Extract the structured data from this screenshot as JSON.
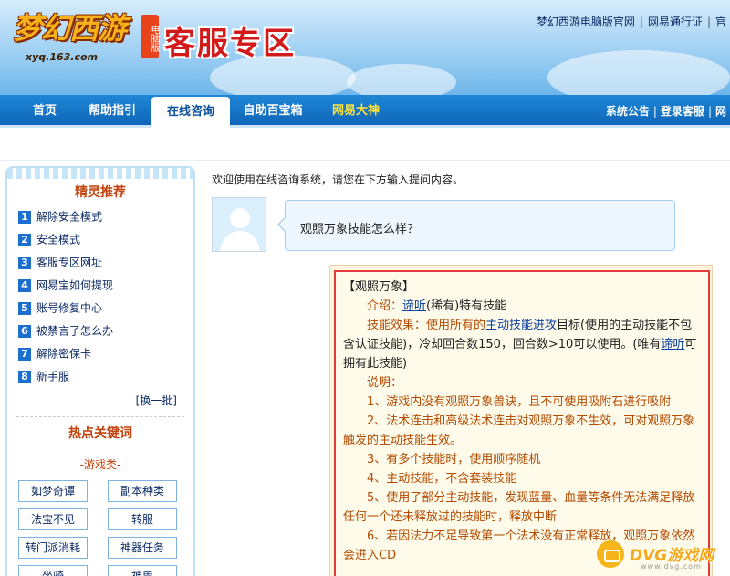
{
  "header": {
    "logo_text": "梦幻西游",
    "logo_badge": "电脑版",
    "logo_url": "xyq.163.com",
    "title": "客服专区",
    "links": [
      "梦幻西游电脑版官网",
      "网易通行证",
      "官"
    ]
  },
  "nav": {
    "tabs": [
      "首页",
      "帮助指引",
      "在线咨询",
      "自助百宝箱",
      "网易大神"
    ],
    "active_index": 2,
    "right_links": [
      "系统公告",
      "登录客服",
      "网"
    ]
  },
  "sidebar": {
    "title": "精灵推荐",
    "items": [
      {
        "num": "1",
        "label": "解除安全模式"
      },
      {
        "num": "2",
        "label": "安全模式"
      },
      {
        "num": "3",
        "label": "客服专区网址"
      },
      {
        "num": "4",
        "label": "网易宝如何提现"
      },
      {
        "num": "5",
        "label": "账号修复中心"
      },
      {
        "num": "6",
        "label": "被禁言了怎么办"
      },
      {
        "num": "7",
        "label": "解除密保卡"
      },
      {
        "num": "8",
        "label": "新手服"
      }
    ],
    "refresh_label": "[换一批]",
    "keywords_title": "热点关键词",
    "keywords_category": "-游戏类-",
    "keywords": [
      "如梦奇谭",
      "副本种类",
      "法宝不见",
      "转服",
      "转门派消耗",
      "神器任务",
      "坐骑",
      "神兽"
    ]
  },
  "main": {
    "welcome": "欢迎使用在线咨询系统，请您在下方输入提问内容。",
    "question": "观照万象技能怎么样？",
    "answer": {
      "heading": "【观照万象】",
      "intro_label": "介绍：",
      "intro_link": "谛听",
      "intro_rest": "(稀有)特有技能",
      "effect_label": "技能效果：使用所有的",
      "effect_link": "主动技能进攻",
      "effect_rest": "目标(使用的主动技能不包含认证技能)，冷却回合数150，回合数>10可以使用。(唯有",
      "effect_link2": "谛听",
      "effect_rest2": "可拥有此技能)",
      "notes_label": "说明：",
      "notes": [
        "1、游戏内没有观照万象兽诀，且不可使用吸附石进行吸附",
        "2、法术连击和高级法术连击对观照万象不生效，可对观照万象触发的主动技能生效。",
        "3、有多个技能时，使用顺序随机",
        "4、主动技能，不含套装技能",
        "5、使用了部分主动技能，发现蓝量、血量等条件无法满足释放任何一个还未释放过的技能时，释放中断",
        "6、若因法力不足导致第一个法术没有正常释放，观照万象依然会进入CD"
      ]
    }
  },
  "watermark": {
    "text": "DVG游戏网",
    "sub": "www.dvg.com"
  }
}
